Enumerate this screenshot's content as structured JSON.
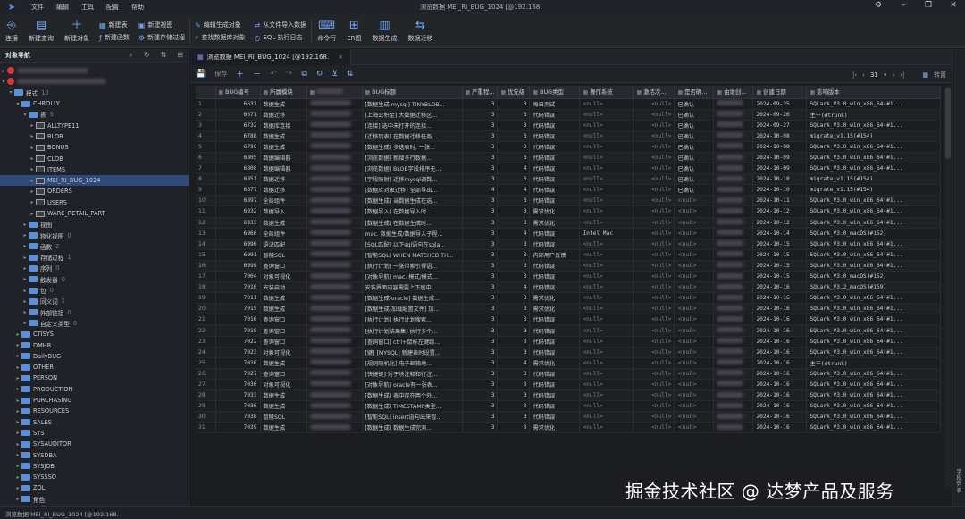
{
  "app": {
    "window_title": "浏览数据 MEI_RI_BUG_1024 [@192.168.",
    "menu": [
      "文件",
      "编辑",
      "工具",
      "配置",
      "帮助"
    ]
  },
  "toolbar": {
    "big": [
      {
        "label": "连接",
        "icon": "connect-icon"
      },
      {
        "label": "新建查询",
        "icon": "new-query-icon"
      },
      {
        "label": "新建对象",
        "icon": "new-object-icon"
      }
    ],
    "small1": [
      "新建表",
      "新建视图",
      "新建函数"
    ],
    "small2": [
      "新建视图",
      "新建存储过程"
    ],
    "small3": [
      "编辑生成对象",
      "查找数据库对象"
    ],
    "small4": [
      "从文件导入数据",
      "SQL 执行日志"
    ],
    "big2": [
      {
        "label": "命令行",
        "icon": "terminal-icon"
      },
      {
        "label": "ER图",
        "icon": "er-icon"
      },
      {
        "label": "数据生成",
        "icon": "data-gen-icon"
      },
      {
        "label": "数据迁移",
        "icon": "migrate-icon"
      }
    ]
  },
  "sidebar": {
    "title": "对象导航",
    "schema_label": "模式",
    "schema_count": "10",
    "root_schema": "CHROLLY",
    "tables_label": "表",
    "tables_count": "9",
    "tables": [
      "ALLTYPE11",
      "BLOB",
      "BONUS",
      "CLOB",
      "ITEMS",
      "MEI_RI_BUG_1024",
      "ORDERS",
      "USERS",
      "WARE_RETAIL_PART"
    ],
    "groups": [
      {
        "label": "视图",
        "count": ""
      },
      {
        "label": "物化视图",
        "count": "0"
      },
      {
        "label": "函数",
        "count": "2"
      },
      {
        "label": "存储过程",
        "count": "1"
      },
      {
        "label": "序列",
        "count": "0"
      },
      {
        "label": "触发器",
        "count": "0"
      },
      {
        "label": "包",
        "count": "0"
      },
      {
        "label": "同义词",
        "count": "1"
      },
      {
        "label": "外部链接",
        "count": "0"
      },
      {
        "label": "自定义类型",
        "count": "0"
      }
    ],
    "schemas": [
      "CTISYS",
      "DMHR",
      "DailyBUG",
      "OTHER",
      "PERSON",
      "PRODUCTION",
      "PURCHASING",
      "RESOURCES",
      "SALES",
      "SYS",
      "SYSAUDITOR",
      "SYSDBA",
      "SYSJOB",
      "SYSSSO",
      "ZQL"
    ],
    "more": "角色"
  },
  "tab": {
    "label": "浏览数据 MEI_RI_BUG_1024 [@192.168.",
    "close": "×"
  },
  "grid_toolbar": {
    "save": "保存",
    "page": "31",
    "page_suffix": "▾",
    "view": "转置"
  },
  "grid": {
    "columns": [
      "",
      "BUG编号",
      "所属模块",
      "",
      "BUG标题",
      "严重程...",
      "优先级",
      "BUG类型",
      "操作系统",
      "激活次...",
      "是否确...",
      "由谁创...",
      "创建日期",
      "影响版本"
    ],
    "rows": [
      [
        "1",
        "6631",
        "数据生成",
        "[数据生成-mysql] TINYBLOB...",
        "3",
        "3",
        "每日测试",
        "<null>",
        "<null>",
        "",
        "已确认",
        "2024-09-25",
        "SQLark_V3.0_win_x86_64(#1..."
      ],
      [
        "2",
        "6671",
        "数据迁移",
        "[上海公积金] 大数据迁移区...",
        "3",
        "3",
        "代码错误",
        "<null>",
        "<null>",
        "",
        "已确认",
        "2024-09-26",
        "主干(#trunk)"
      ],
      [
        "3",
        "6732",
        "数据库连接",
        "[连接] 选中未打开的连接...",
        "3",
        "3",
        "代码错误",
        "<null>",
        "<null>",
        "1",
        "已确认",
        "2024-09-27",
        "SQLark_V3.0_win_x86_64(#1..."
      ],
      [
        "4",
        "6788",
        "数据生成",
        "[迁移列表] 在数据迁移任务...",
        "3",
        "3",
        "代码错误",
        "<null>",
        "<null>",
        "",
        "已确认",
        "2024-10-08",
        "migrate_v1.15(#154)"
      ],
      [
        "5",
        "6790",
        "数据生成",
        "[数据生成] 多选表时, 一张...",
        "3",
        "3",
        "代码错误",
        "<null>",
        "<null>",
        "1",
        "已确认",
        "2024-10-08",
        "SQLark_V3.0_win_x86_64(#1..."
      ],
      [
        "6",
        "6805",
        "数据编辑器",
        "[浏览数据] 新增多行数据...",
        "3",
        "3",
        "代码错误",
        "<null>",
        "<null>",
        "1",
        "已确认",
        "2024-10-09",
        "SQLark_V3.0_win_x86_64(#1..."
      ],
      [
        "7",
        "6808",
        "数据编辑器",
        "[浏览数据] BLOB字段排序无...",
        "3",
        "4",
        "代码错误",
        "<null>",
        "<null>",
        "1",
        "已确认",
        "2024-10-09",
        "SQLark_V3.0_win_x86_64(#1..."
      ],
      [
        "8",
        "6851",
        "数据迁移",
        "[字段映射] 迁移mysql调数...",
        "3",
        "3",
        "代码错误",
        "<null>",
        "<null>",
        "",
        "已确认",
        "2024-10-10",
        "migrate_v1.15(#154)"
      ],
      [
        "9",
        "6877",
        "数据迁移",
        "[数据库对象迁移] 全部导出...",
        "4",
        "4",
        "代码错误",
        "<null>",
        "<null>",
        "",
        "已确认",
        "2024-10-10",
        "migrate_v1.15(#154)"
      ],
      [
        "10",
        "6897",
        "全局组件",
        "[数据生成] 当数据生成在选...",
        "3",
        "3",
        "代码错误",
        "<null>",
        "<null>",
        "",
        "<null>",
        "2024-10-11",
        "SQLark_V3.0_win_x86_64(#1..."
      ],
      [
        "11",
        "6932",
        "数据导入",
        "[数据导入] 在数据导入时...",
        "3",
        "3",
        "需求优化",
        "<null>",
        "<null>",
        "",
        "<null>",
        "2024-10-12",
        "SQLark_V3.0_win_x86_64(#1..."
      ],
      [
        "12",
        "6933",
        "数据生成",
        "[数据生成] 在数据生成时...",
        "3",
        "3",
        "需求优化",
        "<null>",
        "<null>",
        "",
        "<null>",
        "2024-10-12",
        "SQLark_V3.0_win_x86_64(#1..."
      ],
      [
        "13",
        "6960",
        "全局组件",
        "mac. 数据生成/数据导入子程...",
        "3",
        "4",
        "代码错误",
        "Intel Mac",
        "<null>",
        "",
        "<null>",
        "2024-10-14",
        "SQLark_V3.0_macOS(#152)"
      ],
      [
        "14",
        "6990",
        "语法匹配",
        "[SQL匹配] 以下sql语句在sqla...",
        "3",
        "3",
        "代码错误",
        "<null>",
        "<null>",
        "",
        "<null>",
        "2024-10-15",
        "SQLark_V3.0_win_x86_64(#1..."
      ],
      [
        "15",
        "6991",
        "智能SQL",
        "[智能SQL] WHEN MATCHED TH...",
        "3",
        "3",
        "内部用户反馈",
        "<null>",
        "<null>",
        "",
        "<null>",
        "2024-10-15",
        "SQLark_V3.0_win_x86_64(#1..."
      ],
      [
        "16",
        "6998",
        "查询窗口",
        "[执行计划] 一张带索引得语...",
        "3",
        "3",
        "代码错误",
        "<null>",
        "<null>",
        "",
        "<null>",
        "2024-10-15",
        "SQLark_V3.0_win_x86_64(#1..."
      ],
      [
        "17",
        "7004",
        "对象可视化",
        "[对象导航] mac. 模式/模式...",
        "3",
        "3",
        "代码错误",
        "<null>",
        "<null>",
        "",
        "<null>",
        "2024-10-15",
        "SQLark_V3.0_macOS(#152)"
      ],
      [
        "18",
        "7010",
        "安装启动",
        "安装界面内容需要上下居中",
        "3",
        "4",
        "代码错误",
        "<null>",
        "<null>",
        "",
        "<null>",
        "2024-10-16",
        "SQLark_V3.2_macOS(#159)"
      ],
      [
        "19",
        "7011",
        "数据生成",
        "[数据生成-oracle] 数据生成...",
        "3",
        "3",
        "需求优化",
        "<null>",
        "<null>",
        "",
        "<null>",
        "2024-10-16",
        "SQLark_V3.0_win_x86_64(#1..."
      ],
      [
        "20",
        "7015",
        "数据生成",
        "[数据生成-加载配置文件] 加...",
        "3",
        "3",
        "需求优化",
        "<null>",
        "<null>",
        "",
        "<null>",
        "2024-10-16",
        "SQLark_V3.0_win_x86_64(#1..."
      ],
      [
        "21",
        "7016",
        "查询窗口",
        "[执行计划] 执行计划搜索...",
        "3",
        "3",
        "代码错误",
        "<null>",
        "<null>",
        "",
        "<null>",
        "2024-10-16",
        "SQLark_V3.0_win_x86_64(#1..."
      ],
      [
        "22",
        "7018",
        "查询窗口",
        "[执行计划结果集] 执行多个...",
        "3",
        "3",
        "代码错误",
        "<null>",
        "<null>",
        "",
        "<null>",
        "2024-10-16",
        "SQLark_V3.0_win_x86_64(#1..."
      ],
      [
        "23",
        "7022",
        "查询窗口",
        "[查询窗口] ctrl+鼠标左键跳...",
        "3",
        "3",
        "代码错误",
        "<null>",
        "<null>",
        "",
        "<null>",
        "2024-10-16",
        "SQLark_V3.0_win_x86_64(#1..."
      ],
      [
        "24",
        "7023",
        "对象可视化",
        "[键] [MYSQL] 新建表时设置...",
        "3",
        "3",
        "代码错误",
        "<null>",
        "<null>",
        "",
        "<null>",
        "2024-10-16",
        "SQLark_V3.0_win_x86_64(#1..."
      ],
      [
        "25",
        "7026",
        "数据生成",
        "[规则随机化] 电子邮箱地...",
        "3",
        "4",
        "需求优化",
        "<null>",
        "<null>",
        "",
        "<null>",
        "2024-10-16",
        "主干(#trunk)"
      ],
      [
        "26",
        "7027",
        "查询窗口",
        "[快捷键] 对于块注释和行注...",
        "3",
        "3",
        "代码错误",
        "<null>",
        "<null>",
        "",
        "<null>",
        "2024-10-16",
        "SQLark_V3.0_win_x86_64(#1..."
      ],
      [
        "27",
        "7030",
        "对象可视化",
        "[对象导航] oracle有一张表...",
        "3",
        "3",
        "代码错误",
        "<null>",
        "<null>",
        "",
        "<null>",
        "2024-10-16",
        "SQLark_V3.0_win_x86_64(#1..."
      ],
      [
        "28",
        "7033",
        "数据生成",
        "[数据生成] 表中存在两个外...",
        "3",
        "3",
        "代码错误",
        "<null>",
        "<null>",
        "",
        "<null>",
        "2024-10-16",
        "SQLark_V3.0_win_x86_64(#1..."
      ],
      [
        "29",
        "7036",
        "数据生成",
        "[数据生成] TIMESTAMP类型...",
        "3",
        "3",
        "代码错误",
        "<null>",
        "<null>",
        "",
        "<null>",
        "2024-10-16",
        "SQLark_V3.0_win_x86_64(#1..."
      ],
      [
        "30",
        "7038",
        "智能SQL",
        "[智能SQL] insert语句出来智...",
        "3",
        "3",
        "代码错误",
        "<null>",
        "<null>",
        "",
        "<null>",
        "2024-10-16",
        "SQLark_V3.0_win_x86_64(#1..."
      ],
      [
        "31",
        "7039",
        "数据生成",
        "[数据生成] 数据生成完测...",
        "3",
        "3",
        "需求优化",
        "<null>",
        "<null>",
        "",
        "<null>",
        "2024-10-16",
        "SQLark_V3.0_win_x86_64(#1..."
      ]
    ]
  },
  "right_panel": {
    "label": "字段列表"
  },
  "statusbar": {
    "text": "浏览数据 MEI_RI_BUG_1024 [@192.168."
  },
  "watermark": "掘金技术社区 @ 达梦产品及服务"
}
